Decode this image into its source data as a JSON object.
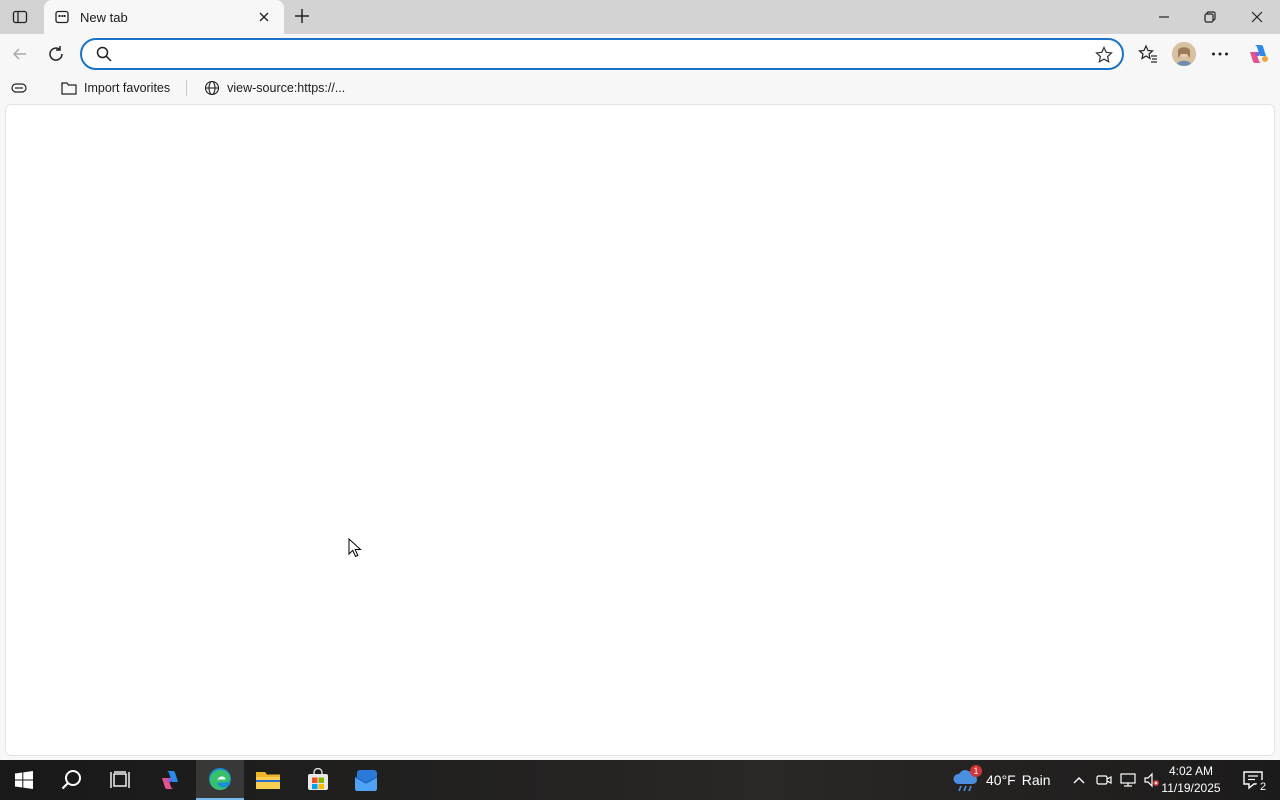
{
  "tab": {
    "title": "New tab"
  },
  "address_bar": {
    "value": "",
    "placeholder": ""
  },
  "favorites": [
    {
      "label": "Import favorites"
    },
    {
      "label": "view-source:https://..."
    }
  ],
  "taskbar": {
    "weather": {
      "temp": "40°F",
      "condition": "Rain",
      "alert_count": "1"
    },
    "clock": {
      "time": "4:02 AM",
      "date": "11/19/2025"
    },
    "notification_count": "2"
  },
  "colors": {
    "accent": "#1a73c9",
    "taskbar": "#1b1a1a",
    "chrome": "#f7f7f7"
  }
}
